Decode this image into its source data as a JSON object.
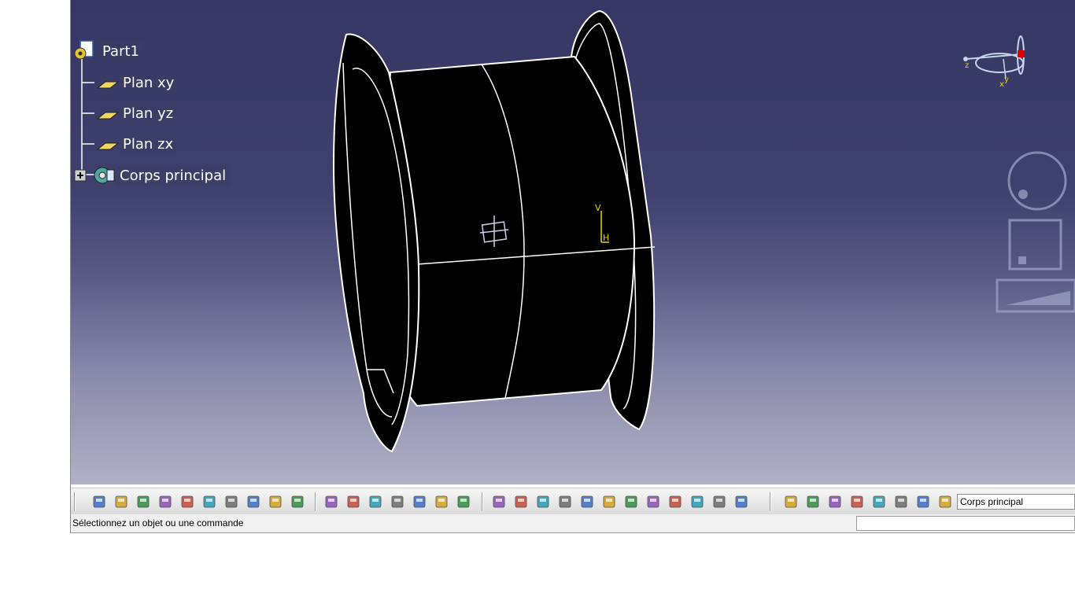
{
  "spec_tree": {
    "root": {
      "label": "Part1",
      "icon": "part-document-icon"
    },
    "items": [
      {
        "label": "Plan xy",
        "icon": "plane-icon"
      },
      {
        "label": "Plan yz",
        "icon": "plane-icon"
      },
      {
        "label": "Plan zx",
        "icon": "plane-icon"
      },
      {
        "label": "Corps principal",
        "icon": "body-gear-icon",
        "expander": "plus"
      }
    ]
  },
  "compass": {
    "axes": [
      "x",
      "y",
      "z"
    ]
  },
  "sketch_axis": {
    "v_label": "V",
    "h_label": "H"
  },
  "colors": {
    "background_top": "#363663",
    "background_bottom": "#b0b2c6",
    "part_fill": "#000000",
    "edges": "#ffffff",
    "sketch_axis": "#e6d400",
    "compass_accent": "#e00000"
  },
  "toolbar": {
    "icons": [
      "new-icon",
      "open-icon",
      "save-icon",
      "print-icon",
      "cut-icon",
      "copy-icon",
      "paste-icon",
      "undo-icon",
      "redo-icon",
      "whats-this-icon",
      "formula-icon",
      "comment-icon",
      "knowledge-icon",
      "table-icon",
      "tree-icon",
      "lock-icon",
      "catalog-icon",
      "fly-icon",
      "fit-all-icon",
      "pan-icon",
      "rotate-icon",
      "zoom-in-icon",
      "zoom-out-icon",
      "normal-view-icon",
      "multi-view-icon",
      "iso-view-icon",
      "shading-icon",
      "hide-show-icon",
      "swap-space-icon",
      "update-icon",
      "manipulate-icon",
      "axis-system-icon",
      "dimension-icon",
      "constraint-icon",
      "analysis-icon",
      "list-icon",
      "layer-icon"
    ],
    "current_body": "Corps principal"
  },
  "status_bar": {
    "message": "Sélectionnez un objet ou une commande"
  }
}
